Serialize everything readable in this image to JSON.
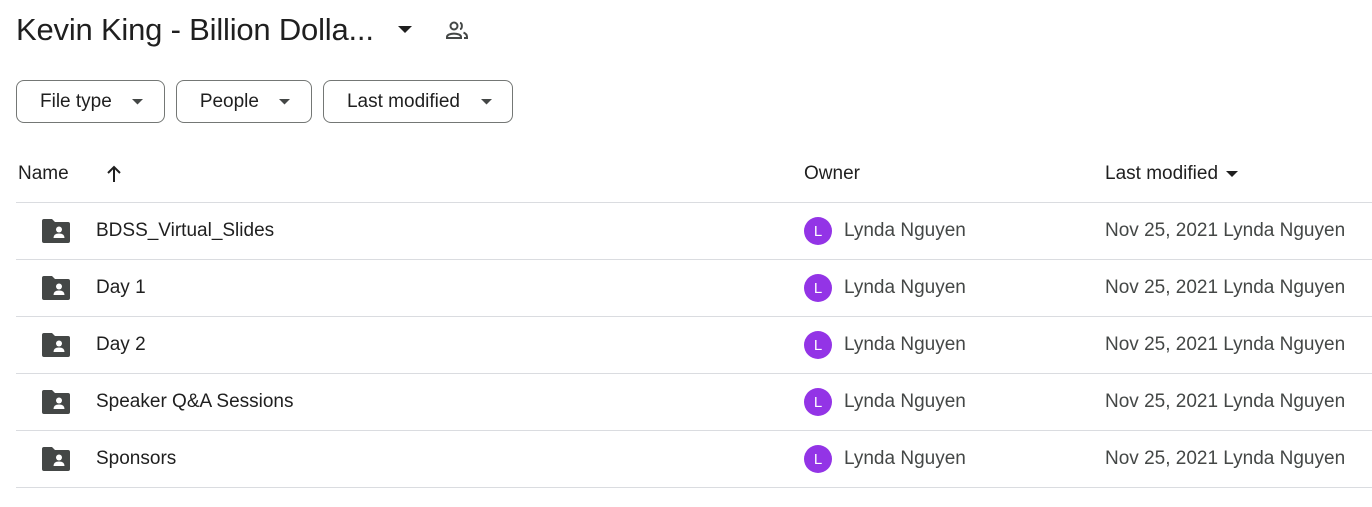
{
  "header": {
    "title": "Kevin King - Billion Dolla...",
    "caret_icon": "caret-down-icon",
    "shared_icon": "people-icon"
  },
  "filters": [
    {
      "label": "File type"
    },
    {
      "label": "People"
    },
    {
      "label": "Last modified"
    }
  ],
  "columns": {
    "name": "Name",
    "owner": "Owner",
    "last_modified": "Last modified",
    "sort_icon": "arrow-up-icon"
  },
  "colors": {
    "avatar": "#9334e6",
    "folder_icon": "#444746",
    "divider": "#dadce0"
  },
  "rows": [
    {
      "name": "BDSS_Virtual_Slides",
      "owner_initial": "L",
      "owner": "Lynda Nguyen",
      "modified": "Nov 25, 2021 Lynda Nguyen"
    },
    {
      "name": "Day 1",
      "owner_initial": "L",
      "owner": "Lynda Nguyen",
      "modified": "Nov 25, 2021 Lynda Nguyen"
    },
    {
      "name": "Day 2",
      "owner_initial": "L",
      "owner": "Lynda Nguyen",
      "modified": "Nov 25, 2021 Lynda Nguyen"
    },
    {
      "name": "Speaker Q&A Sessions",
      "owner_initial": "L",
      "owner": "Lynda Nguyen",
      "modified": "Nov 25, 2021 Lynda Nguyen"
    },
    {
      "name": "Sponsors",
      "owner_initial": "L",
      "owner": "Lynda Nguyen",
      "modified": "Nov 25, 2021 Lynda Nguyen"
    }
  ]
}
